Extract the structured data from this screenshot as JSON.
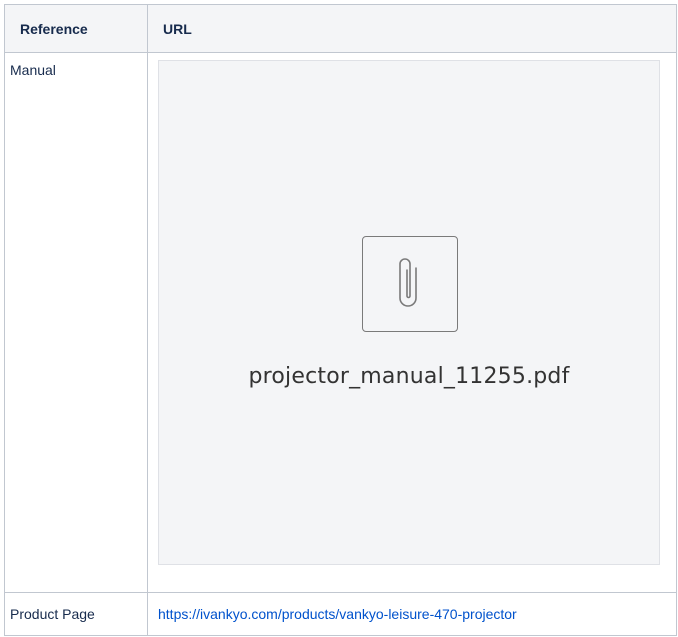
{
  "table": {
    "headers": [
      "Reference",
      "URL"
    ],
    "rows": [
      {
        "reference": "Manual",
        "attachment": {
          "icon": "paperclip-icon",
          "filename": "projector_manual_11255.pdf"
        }
      },
      {
        "reference": "Product Page",
        "link_text": "https://ivankyo.com/products/vankyo-leisure-470-projector"
      }
    ]
  },
  "colors": {
    "header_bg": "#f4f5f7",
    "border": "#c1c7d0",
    "link": "#0052cc",
    "attachment_bg": "#f4f5f7"
  }
}
